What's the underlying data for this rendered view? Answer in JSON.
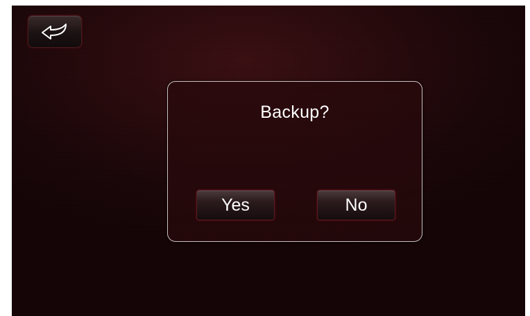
{
  "toolbar": {
    "back_icon": "back-arrow-icon"
  },
  "dialog": {
    "title": "Backup?",
    "yes_label": "Yes",
    "no_label": "No"
  },
  "colors": {
    "background": "#1a0608",
    "accent": "#5a1c22",
    "text": "#ffffff",
    "dialog_border": "#c9c2c2"
  }
}
